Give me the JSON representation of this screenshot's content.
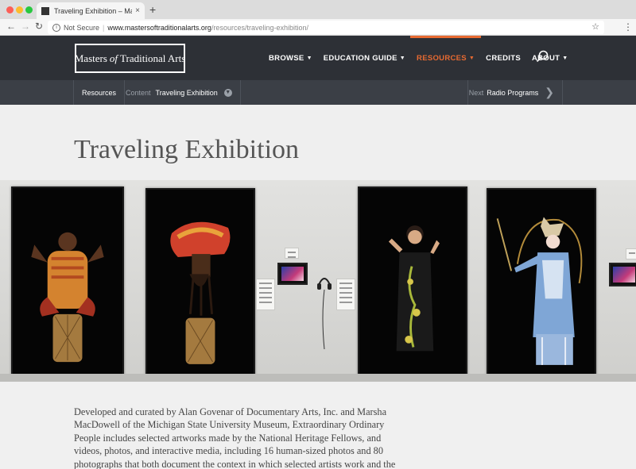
{
  "browser": {
    "tab_title": "Traveling Exhibition – Masters",
    "tab_close": "×",
    "new_tab": "+",
    "security_label": "Not Secure",
    "url_host": "www.mastersoftraditionalarts.org",
    "url_path": "/resources/traveling-exhibition/",
    "icons": [
      "back-arrow-icon",
      "forward-arrow-icon",
      "reload-icon",
      "info-icon",
      "star-icon",
      "menu-kebab-icon"
    ]
  },
  "site": {
    "logo": {
      "part1": "Masters",
      "part2": "of",
      "part3": "Traditional Arts"
    },
    "nav": [
      {
        "label": "BROWSE",
        "caret": true,
        "active": false
      },
      {
        "label": "EDUCATION GUIDE",
        "caret": true,
        "active": false
      },
      {
        "label": "RESOURCES",
        "caret": true,
        "active": true
      },
      {
        "label": "CREDITS",
        "caret": false,
        "active": false
      },
      {
        "label": "ABOUT",
        "caret": true,
        "active": false
      }
    ],
    "accent_color": "#e86a31",
    "header_bg": "#2d3036"
  },
  "subnav": {
    "resources": "Resources",
    "content_label": "Content",
    "content_value": "Traveling Exhibition",
    "next_label": "Next",
    "next_value": "Radio Programs"
  },
  "page": {
    "title": "Traveling Exhibition",
    "body": "Developed and curated by Alan Govenar of Documentary Arts, Inc. and Marsha MacDowell of the Michigan State University Museum, Extraordinary Ordinary People includes selected artworks made by the National Heritage Fellows, and videos, photos, and interactive media, including 16 human-sized photos and 80 photographs that both document the context in which selected artists work and the process through which"
  }
}
